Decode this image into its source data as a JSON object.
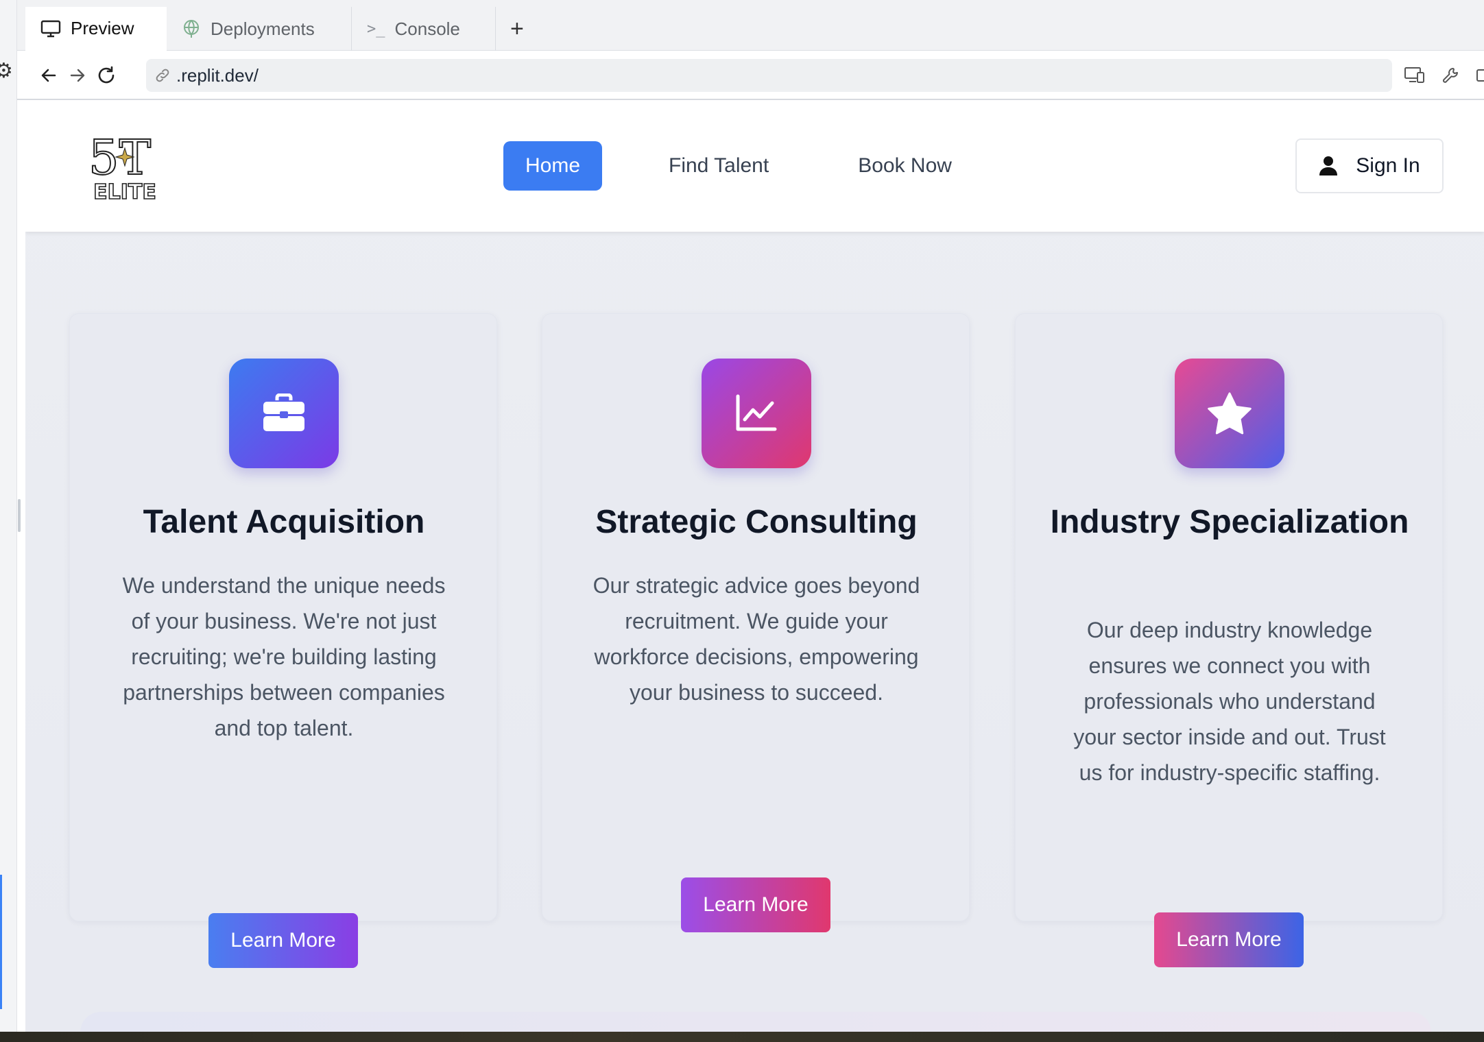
{
  "browser": {
    "tabs": [
      {
        "label": "Preview",
        "icon": "monitor-icon",
        "active": true
      },
      {
        "label": "Deployments",
        "icon": "globe-icon",
        "active": false
      },
      {
        "label": "Console",
        "icon": "terminal-icon",
        "active": false
      }
    ],
    "add_tab": "+",
    "url": ".replit.dev/"
  },
  "site": {
    "logo": {
      "line1": "5T",
      "line2": "ELITE"
    },
    "nav": {
      "home": "Home",
      "find_talent": "Find Talent",
      "book_now": "Book Now"
    },
    "sign_in": "Sign In",
    "colors": {
      "primary": "#3b7cf2",
      "heading": "#111827",
      "body": "#4b5563"
    }
  },
  "cards": [
    {
      "icon": "briefcase-icon",
      "title": "Talent Acquisition",
      "text": "We understand the unique needs of your business. We're not just recruiting; we're building lasting partnerships between companies and top talent.",
      "button": "Learn More"
    },
    {
      "icon": "chart-line-icon",
      "title": "Strategic Consulting",
      "text": "Our strategic advice goes beyond recruitment. We guide your workforce decisions, empowering your business to succeed.",
      "button": "Learn More"
    },
    {
      "icon": "star-icon",
      "title": "Industry Specialization",
      "text": "Our deep industry knowledge ensures we connect you with professionals who understand your sector inside and out. Trust us for industry-specific staffing.",
      "button": "Learn More"
    }
  ]
}
